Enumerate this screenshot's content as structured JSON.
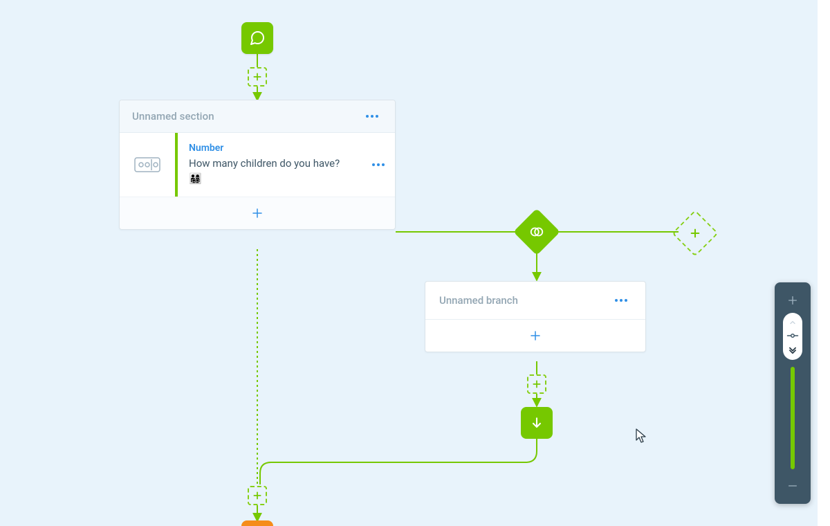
{
  "colors": {
    "accent_green": "#76c800",
    "accent_blue": "#2f8fe6",
    "bg": "#e8f3fb",
    "orange": "#f58c1a"
  },
  "section": {
    "title": "Unnamed section",
    "question": {
      "type_label": "Number",
      "text": "How many children do you have? 👨‍👩‍👧‍👦"
    }
  },
  "branch": {
    "title": "Unnamed branch"
  },
  "icons": {
    "start": "chat-icon",
    "condition": "branch-icon",
    "end": "arrow-down-icon"
  }
}
